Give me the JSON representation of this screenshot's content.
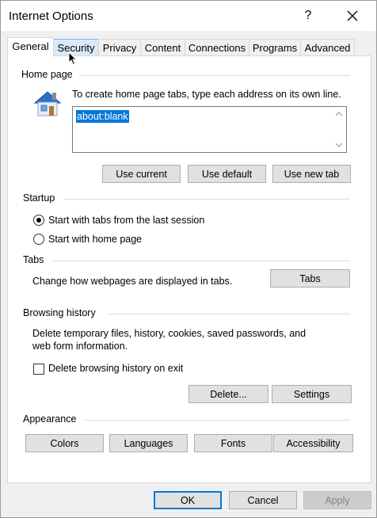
{
  "window": {
    "title": "Internet Options",
    "help": "?"
  },
  "tabs": [
    "General",
    "Security",
    "Privacy",
    "Content",
    "Connections",
    "Programs",
    "Advanced"
  ],
  "home_page": {
    "label": "Home page",
    "instruction": "To create home page tabs, type each address on its own line.",
    "value": "about:blank",
    "buttons": [
      "Use current",
      "Use default",
      "Use new tab"
    ]
  },
  "startup": {
    "label": "Startup",
    "options": [
      "Start with tabs from the last session",
      "Start with home page"
    ],
    "selected_index": 0
  },
  "tabs_section": {
    "label": "Tabs",
    "description": "Change how webpages are displayed in tabs.",
    "button": "Tabs"
  },
  "browsing_history": {
    "label": "Browsing history",
    "description_line1": "Delete temporary files, history, cookies, saved passwords, and",
    "description_line2": "web form information.",
    "checkbox_label": "Delete browsing history on exit",
    "checkbox_checked": false,
    "delete_button": "Delete...",
    "settings_button": "Settings"
  },
  "appearance": {
    "label": "Appearance",
    "buttons": [
      "Colors",
      "Languages",
      "Fonts",
      "Accessibility"
    ]
  },
  "footer": {
    "ok": "OK",
    "cancel": "Cancel",
    "apply": "Apply"
  },
  "icons": {
    "house": "home-page-house-icon",
    "close": "close-icon",
    "pointer": "mouse-pointer-icon"
  },
  "colors": {
    "selection": "#0078d7",
    "button_face": "#e1e1e1",
    "tab_hover": "#d8eaf9"
  }
}
